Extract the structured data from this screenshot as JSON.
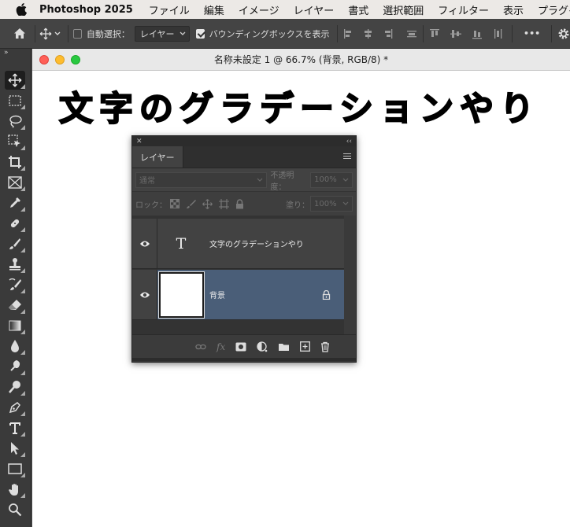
{
  "menubar": {
    "app_name": "Photoshop 2025",
    "items": [
      "ファイル",
      "編集",
      "イメージ",
      "レイヤー",
      "書式",
      "選択範囲",
      "フィルター",
      "表示",
      "プラグイン"
    ]
  },
  "options_bar": {
    "auto_select_label": "自動選択：",
    "auto_select_value": "レイヤー",
    "bounding_box_label": "バウンディングボックスを表示",
    "more_label": "•••"
  },
  "document": {
    "title": "名称未設定 1 @ 66.7% (背景, RGB/8) *",
    "canvas_text": "文字のグラデーションやり"
  },
  "layers_panel": {
    "tab_label": "レイヤー",
    "blend_mode": "通常",
    "opacity_label": "不透明度：",
    "opacity_value": "100%",
    "lock_label": "ロック：",
    "fill_label": "塗り：",
    "fill_value": "100%",
    "layers": [
      {
        "name": "文字のグラデーションやり",
        "type": "text",
        "thumb": "T"
      },
      {
        "name": "背景",
        "type": "background"
      }
    ]
  },
  "colors": {
    "selected_layer": "#4a5e78",
    "panel_bg": "#383838",
    "toolbar_bg": "#3a3a3a"
  }
}
